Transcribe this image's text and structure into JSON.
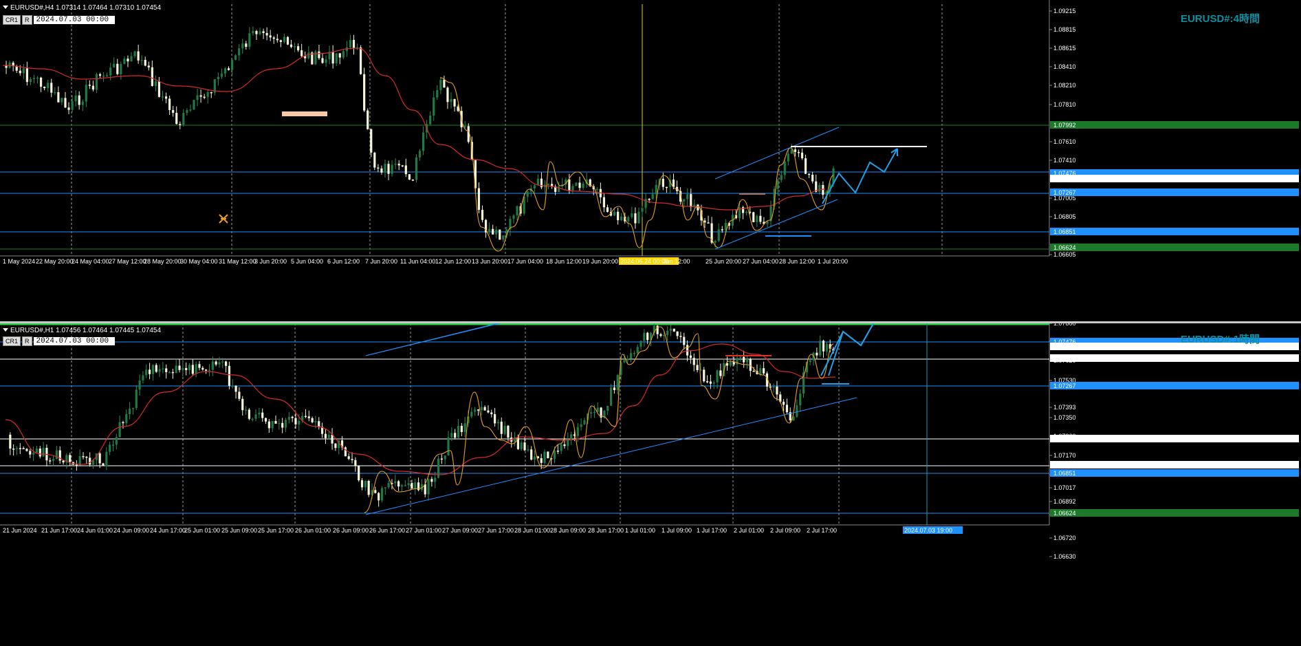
{
  "top": {
    "header": "EURUSD#,H4  1.07314 1.07464 1.07310 1.07454",
    "tb_cr": "CR1",
    "tb_r": "R",
    "datetime_value": "2024.07.03 00:00",
    "title": "EURUSD#:4時間",
    "price_labels": [
      "1.09215",
      "1.08815",
      "1.08615",
      "1.08410",
      "1.08210",
      "1.07810",
      "1.07610",
      "1.07410",
      "1.07205",
      "1.07005",
      "1.06805",
      "1.06605"
    ],
    "time_labels": [
      "1 May 2024",
      "22 May 20:00",
      "24 May 04:00",
      "27 May 12:00",
      "28 May 20:00",
      "30 May 04:00",
      "31 May 12:00",
      "3 Jun 20:00",
      "5 Jun 04:00",
      "6 Jun 12:00",
      "7 Jun 20:00",
      "11 Jun 04:00",
      "12 Jun 12:00",
      "13 Jun 20:00",
      "17 Jun 04:00",
      "18 Jun 12:00",
      "19 Jun 20:00",
      "2024.06.24 00:00",
      "Jun 12:00",
      "25 Jun 20:00",
      "27 Jun 04:00",
      "28 Jun 12:00",
      "1 Jul 20:00"
    ],
    "level_tags": [
      {
        "text": "1.07992",
        "color": "#1a7a2a"
      },
      {
        "text": "1.07476",
        "color": "#1e90ff"
      },
      {
        "text": "1.07454",
        "color": "#ffffff"
      },
      {
        "text": "1.07267",
        "color": "#1e90ff"
      },
      {
        "text": "1.06851",
        "color": "#1e90ff"
      },
      {
        "text": "1.06624",
        "color": "#1a7a2a"
      }
    ]
  },
  "bottom": {
    "header": "EURUSD#,H1  1.07456 1.07464 1.07445 1.07454",
    "tb_cr": "CR1",
    "tb_r": "R",
    "datetime_value": "2024.07.03 00:00",
    "title": "EURUSD#:1時間",
    "price_labels": [
      "1.07800",
      "1.07710",
      "1.07620",
      "1.07530",
      "1.07393",
      "1.07350",
      "1.07260",
      "1.07170",
      "1.07080",
      "1.07017",
      "1.06892",
      "1.06851",
      "1.06720",
      "1.06630"
    ],
    "time_labels": [
      "21 Jun 2024",
      "21 Jun 17:00",
      "24 Jun 01:00",
      "24 Jun 09:00",
      "24 Jun 17:00",
      "25 Jun 01:00",
      "25 Jun 09:00",
      "25 Jun 17:00",
      "26 Jun 01:00",
      "26 Jun 09:00",
      "26 Jun 17:00",
      "27 Jun 01:00",
      "27 Jun 09:00",
      "27 Jun 17:00",
      "28 Jun 01:00",
      "28 Jun 09:00",
      "28 Jun 17:00",
      "1 Jul 01:00",
      "1 Jul 09:00",
      "1 Jul 17:00",
      "2 Jul 01:00",
      "2 Jul 09:00",
      "2 Jul 17:00",
      "2024.07.03 19:00"
    ],
    "level_tags": [
      {
        "text": "1.07476",
        "color": "#1e90ff"
      },
      {
        "text": "1.07454",
        "color": "#ffffff"
      },
      {
        "text": "1.07393",
        "color": "#ffffff"
      },
      {
        "text": "1.07267",
        "color": "#1e90ff"
      },
      {
        "text": "1.07017",
        "color": "#ffffff"
      },
      {
        "text": "1.06892",
        "color": "#ffffff"
      },
      {
        "text": "1.06851",
        "color": "#1e90ff"
      },
      {
        "text": "1.06624",
        "color": "#1a7a2a"
      }
    ]
  },
  "chart_data": [
    {
      "type": "candlestick",
      "symbol": "EURUSD#",
      "timeframe": "H4",
      "title": "EURUSD#:4時間",
      "ylim": [
        1.06605,
        1.09215
      ],
      "horizontal_levels": [
        1.07992,
        1.07476,
        1.07267,
        1.06851,
        1.06624
      ],
      "grid": true
    },
    {
      "type": "candlestick",
      "symbol": "EURUSD#",
      "timeframe": "H1",
      "title": "EURUSD#:1時間",
      "ylim": [
        1.0663,
        1.078
      ],
      "horizontal_levels": [
        1.07476,
        1.07393,
        1.07267,
        1.07017,
        1.06892,
        1.06851,
        1.06624
      ],
      "grid": true
    }
  ]
}
